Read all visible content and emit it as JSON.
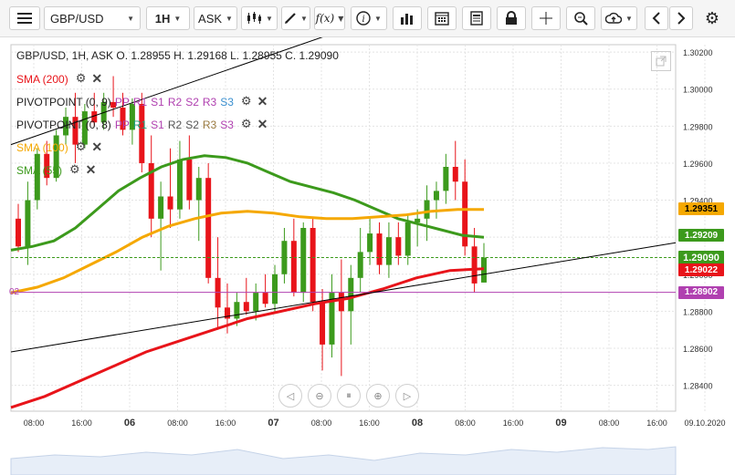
{
  "toolbar": {
    "symbol": "GBP/USD",
    "timeframe": "1H",
    "price_type": "ASK",
    "fx_label": "f(x)",
    "icons": [
      "menu-icon",
      "candlestick-icon",
      "pencil-icon",
      "function-icon",
      "info-icon",
      "bar-chart-icon",
      "calendar-icon",
      "news-icon",
      "lock-icon",
      "crosshair-icon",
      "zoom-icon",
      "cloud-upload-icon",
      "chevron-left-icon",
      "chevron-right-icon",
      "gear-icon"
    ]
  },
  "header": {
    "ohlc": "GBP/USD, 1H, ASK   O. 1.28955 H. 1.29168 L. 1.28955 C. 1.29090"
  },
  "legend": [
    {
      "label": "SMA (200)",
      "color": "#e8141a",
      "parts": []
    },
    {
      "label": "PIVOTPOINT (0, 9)",
      "color": "#222222",
      "parts": [
        {
          "t": "PP",
          "c": "#b040b0"
        },
        {
          "t": "R1",
          "c": "#b040b0"
        },
        {
          "t": "S1",
          "c": "#b040b0"
        },
        {
          "t": "R2",
          "c": "#b040b0"
        },
        {
          "t": "S2",
          "c": "#b040b0"
        },
        {
          "t": "R3",
          "c": "#b040b0"
        },
        {
          "t": "S3",
          "c": "#3a8fcf"
        }
      ]
    },
    {
      "label": "PIVOTPOINT (0, 8)",
      "color": "#222222",
      "parts": [
        {
          "t": "PP",
          "c": "#b040b0"
        },
        {
          "t": "R1",
          "c": "#1fa07a"
        },
        {
          "t": "S1",
          "c": "#b040b0"
        },
        {
          "t": "R2",
          "c": "#555555"
        },
        {
          "t": "S2",
          "c": "#555555"
        },
        {
          "t": "R3",
          "c": "#9a7a40"
        },
        {
          "t": "S3",
          "c": "#b040b0"
        }
      ]
    },
    {
      "label": "SMA (100)",
      "color": "#f5a800",
      "parts": []
    },
    {
      "label": "SMA (55)",
      "color": "#3c9a1c",
      "parts": []
    }
  ],
  "price_axis": {
    "ticks": [
      "1.30200",
      "1.30000",
      "1.29800",
      "1.29600",
      "1.29400",
      "1.29200",
      "1.29000",
      "1.28800",
      "1.28600",
      "1.28400"
    ],
    "tags": [
      {
        "label": "1.29351",
        "value": 1.29351,
        "bg": "#f5a800"
      },
      {
        "label": "1.29209",
        "value": 1.29209,
        "bg": "#3c9a1c"
      },
      {
        "label": "1.29090",
        "value": 1.2909,
        "bg": "#3c9a1c"
      },
      {
        "label": "1.29022",
        "value": 1.29022,
        "bg": "#e8141a"
      },
      {
        "label": "1.28902",
        "value": 1.28902,
        "bg": "#b040b0"
      }
    ]
  },
  "time_axis": {
    "labels": [
      "08:00",
      "16:00",
      "06",
      "08:00",
      "16:00",
      "07",
      "08:00",
      "16:00",
      "08",
      "08:00",
      "16:00",
      "09",
      "08:00",
      "16:00",
      "09.10.2020"
    ]
  },
  "left_edge_label": "02",
  "colors": {
    "bull": "#3c9a1c",
    "bear": "#e8141a",
    "sma200": "#e8141a",
    "sma100": "#f5a800",
    "sma55": "#3c9a1c",
    "pivot": "#b040b0"
  },
  "chart_data": {
    "type": "line",
    "title": "GBP/USD, 1H, ASK",
    "ylim": [
      1.2826,
      1.3024
    ],
    "ohlc_last": {
      "O": 1.28955,
      "H": 1.29168,
      "L": 1.28955,
      "C": 1.2909
    },
    "candles": [
      [
        1.293,
        1.2938,
        1.2912,
        1.2915
      ],
      [
        1.2915,
        1.295,
        1.2905,
        1.294
      ],
      [
        1.294,
        1.2968,
        1.2935,
        1.2965
      ],
      [
        1.2965,
        1.2972,
        1.2948,
        1.2952
      ],
      [
        1.2952,
        1.2978,
        1.295,
        1.2975
      ],
      [
        1.2975,
        1.299,
        1.297,
        1.2985
      ],
      [
        1.2985,
        1.2998,
        1.296,
        1.297
      ],
      [
        1.297,
        1.2992,
        1.2968,
        1.2988
      ],
      [
        1.2988,
        1.2998,
        1.298,
        1.2982
      ],
      [
        1.2982,
        1.2998,
        1.2978,
        1.2993
      ],
      [
        1.2993,
        1.3007,
        1.2985,
        1.299
      ],
      [
        1.299,
        1.2998,
        1.2975,
        1.2978
      ],
      [
        1.2978,
        1.2995,
        1.297,
        1.2992
      ],
      [
        1.2992,
        1.2998,
        1.2955,
        1.296
      ],
      [
        1.296,
        1.2975,
        1.292,
        1.293
      ],
      [
        1.293,
        1.295,
        1.2902,
        1.2942
      ],
      [
        1.2942,
        1.2968,
        1.2925,
        1.2935
      ],
      [
        1.2935,
        1.2972,
        1.293,
        1.2962
      ],
      [
        1.2962,
        1.2975,
        1.2935,
        1.294
      ],
      [
        1.294,
        1.2958,
        1.2918,
        1.2952
      ],
      [
        1.2952,
        1.296,
        1.2895,
        1.2898
      ],
      [
        1.2898,
        1.292,
        1.287,
        1.2882
      ],
      [
        1.2882,
        1.2895,
        1.2868,
        1.2876
      ],
      [
        1.2876,
        1.289,
        1.2872,
        1.2885
      ],
      [
        1.2885,
        1.2898,
        1.2878,
        1.288
      ],
      [
        1.288,
        1.2895,
        1.2875,
        1.289
      ],
      [
        1.289,
        1.29,
        1.2882,
        1.2884
      ],
      [
        1.2884,
        1.2905,
        1.288,
        1.29
      ],
      [
        1.29,
        1.2925,
        1.2895,
        1.2918
      ],
      [
        1.2918,
        1.293,
        1.2888,
        1.289
      ],
      [
        1.289,
        1.2928,
        1.2885,
        1.2925
      ],
      [
        1.2925,
        1.293,
        1.288,
        1.2885
      ],
      [
        1.2885,
        1.2892,
        1.2848,
        1.2862
      ],
      [
        1.2862,
        1.29,
        1.2855,
        1.289
      ],
      [
        1.289,
        1.2908,
        1.2845,
        1.288
      ],
      [
        1.288,
        1.2905,
        1.2862,
        1.2898
      ],
      [
        1.2898,
        1.2925,
        1.289,
        1.2912
      ],
      [
        1.2912,
        1.293,
        1.2905,
        1.2922
      ],
      [
        1.2922,
        1.2928,
        1.29,
        1.2905
      ],
      [
        1.2905,
        1.2928,
        1.2898,
        1.292
      ],
      [
        1.292,
        1.2928,
        1.2905,
        1.291
      ],
      [
        1.291,
        1.2932,
        1.2905,
        1.2928
      ],
      [
        1.2928,
        1.2935,
        1.2915,
        1.293
      ],
      [
        1.293,
        1.2948,
        1.2918,
        1.294
      ],
      [
        1.294,
        1.295,
        1.293,
        1.2945
      ],
      [
        1.2945,
        1.2965,
        1.2938,
        1.2958
      ],
      [
        1.2958,
        1.2972,
        1.294,
        1.295
      ],
      [
        1.295,
        1.2962,
        1.291,
        1.2915
      ],
      [
        1.2915,
        1.2925,
        1.289,
        1.2895
      ],
      [
        1.28955,
        1.29168,
        1.28955,
        1.2909
      ]
    ],
    "series": [
      {
        "name": "SMA (55)",
        "values": [
          1.2913,
          1.2915,
          1.2918,
          1.2925,
          1.2935,
          1.2945,
          1.2952,
          1.2958,
          1.2962,
          1.2964,
          1.2963,
          1.296,
          1.2955,
          1.295,
          1.2947,
          1.2944,
          1.294,
          1.2935,
          1.293,
          1.2927,
          1.2924,
          1.2921,
          1.292
        ]
      },
      {
        "name": "SMA (100)",
        "values": [
          1.289,
          1.2893,
          1.2898,
          1.2905,
          1.2912,
          1.292,
          1.2926,
          1.293,
          1.2933,
          1.2934,
          1.2933,
          1.2931,
          1.293,
          1.293,
          1.2931,
          1.2932,
          1.2934,
          1.2935,
          1.2935
        ]
      },
      {
        "name": "SMA (200)",
        "values": [
          1.2828,
          1.2834,
          1.2842,
          1.285,
          1.2858,
          1.2864,
          1.287,
          1.2876,
          1.288,
          1.2884,
          1.2887,
          1.2892,
          1.2898,
          1.2902,
          1.2903
        ]
      }
    ],
    "trendlines": [
      {
        "from": [
          0,
          1.2858
        ],
        "to": [
          1,
          1.2917
        ],
        "color": "#000000"
      },
      {
        "from": [
          0,
          1.297
        ],
        "to": [
          0.5,
          1.3032
        ],
        "color": "#000000"
      }
    ],
    "hlines": [
      {
        "value": 1.2909,
        "color": "#3c9a1c",
        "style": "dashed"
      },
      {
        "value": 1.28902,
        "color": "#b040b0",
        "style": "solid"
      }
    ]
  }
}
